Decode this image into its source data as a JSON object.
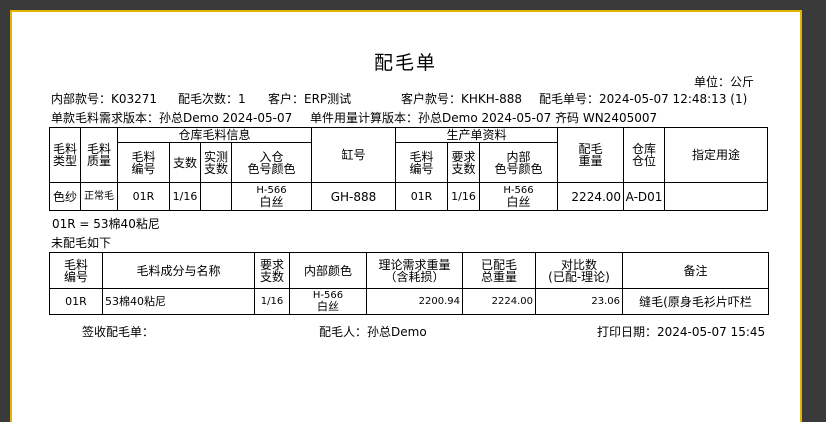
{
  "doc": {
    "title": "配毛单",
    "unit": "单位：公斤",
    "header_row1": {
      "internal_no": "内部款号：K03271",
      "times": "配毛次数：1",
      "customer": "客户：ERP测试",
      "customer_no": "客户款号：KHKH-888",
      "order_no": "配毛单号：2024-05-07 12:48:13 (1)"
    },
    "header_row2": {
      "demand_ver": "单款毛料需求版本：孙总Demo 2024-05-07",
      "calc_ver": "单件用量计算版本：孙总Demo 2024-05-07 齐码 WN2405007"
    }
  },
  "table1": {
    "group_warehouse": "仓库毛料信息",
    "group_production": "生产单资料",
    "headers": {
      "type": [
        "毛料",
        "类型"
      ],
      "quality": [
        "毛料",
        "质量"
      ],
      "wh_code": [
        "毛料",
        "编号"
      ],
      "wh_count": "支数",
      "wh_actual": [
        "实测",
        "支数"
      ],
      "wh_color": [
        "入仓",
        "色号颜色"
      ],
      "vat": "缸号",
      "pr_code": [
        "毛料",
        "编号"
      ],
      "pr_req": [
        "要求",
        "支数"
      ],
      "pr_color": [
        "内部",
        "色号颜色"
      ],
      "weight": [
        "配毛",
        "重量"
      ],
      "location": [
        "仓库",
        "仓位"
      ],
      "usage": "指定用途"
    },
    "row": {
      "type": "色纱",
      "quality": "正常毛",
      "wh_code": "01R",
      "wh_count": "1/16",
      "wh_actual": "",
      "wh_color_code": "H-566",
      "wh_color_name": "白丝",
      "vat": "GH-888",
      "pr_code": "01R",
      "pr_req": "1/16",
      "pr_color_code": "H-566",
      "pr_color_name": "白丝",
      "weight": "2224.00",
      "location": "A-D01",
      "usage": ""
    }
  },
  "note_composition": "01R = 53棉40粘尼",
  "note_unmatched": "未配毛如下",
  "table2": {
    "headers": {
      "code": [
        "毛料",
        "编号"
      ],
      "name": "毛料成分与名称",
      "req": [
        "要求",
        "支数"
      ],
      "color": "内部颜色",
      "theory": [
        "理论需求重量",
        "（含耗损）"
      ],
      "done": [
        "已配毛",
        "总重量"
      ],
      "ratio": [
        "对比数",
        "(已配-理论)"
      ],
      "remark": "备注"
    },
    "row": {
      "code": "01R",
      "name": "53棉40粘尼",
      "req": "1/16",
      "color_code": "H-566",
      "color_name": "白丝",
      "theory": "2200.94",
      "done": "2224.00",
      "ratio": "23.06",
      "remark": "缝毛(原身毛衫片吓栏"
    }
  },
  "footer": {
    "sign": "签收配毛单：",
    "person": "配毛人：孙总Demo",
    "print_date": "打印日期：2024-05-07 15:45"
  },
  "colors": {
    "frame_border": "#e3b400",
    "background": "#3a3a3a",
    "paper": "#ffffff"
  }
}
